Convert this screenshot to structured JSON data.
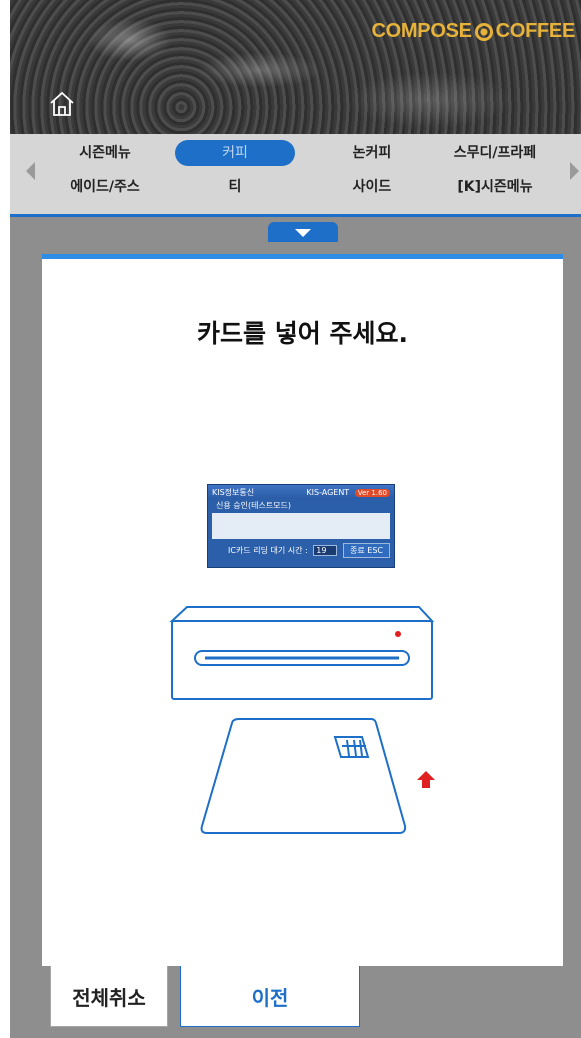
{
  "brand": {
    "name_left": "COMPOSE",
    "name_right": "COFFEE"
  },
  "menu": {
    "row1": [
      {
        "label": "시즌메뉴",
        "active": false
      },
      {
        "label": "커피",
        "active": true
      },
      {
        "label": "논커피",
        "active": false
      },
      {
        "label": "스무디/프라페",
        "active": false
      }
    ],
    "row2": [
      {
        "label": "에이드/주스"
      },
      {
        "label": "티"
      },
      {
        "label": "사이드"
      },
      {
        "label": "[K]시즌메뉴"
      }
    ]
  },
  "modal": {
    "title": "카드를 넣어 주세요.",
    "kis": {
      "left_title": "KIS정보통신",
      "right_title": "KIS-AGENT",
      "version": "Ver 1.60",
      "subtitle": "신용 승인(테스트모드)",
      "wait_label": "IC카드 리딩 대기 시간 :",
      "wait_seconds": "19",
      "esc_label": "종료 ESC"
    }
  },
  "buttons": {
    "cancel_all": "전체취소",
    "prev": "이전"
  },
  "colors": {
    "accent": "#1e6fc8",
    "modal_top": "#2d8ce6",
    "brand": "#e6b23a",
    "indicator": "#e02020"
  }
}
